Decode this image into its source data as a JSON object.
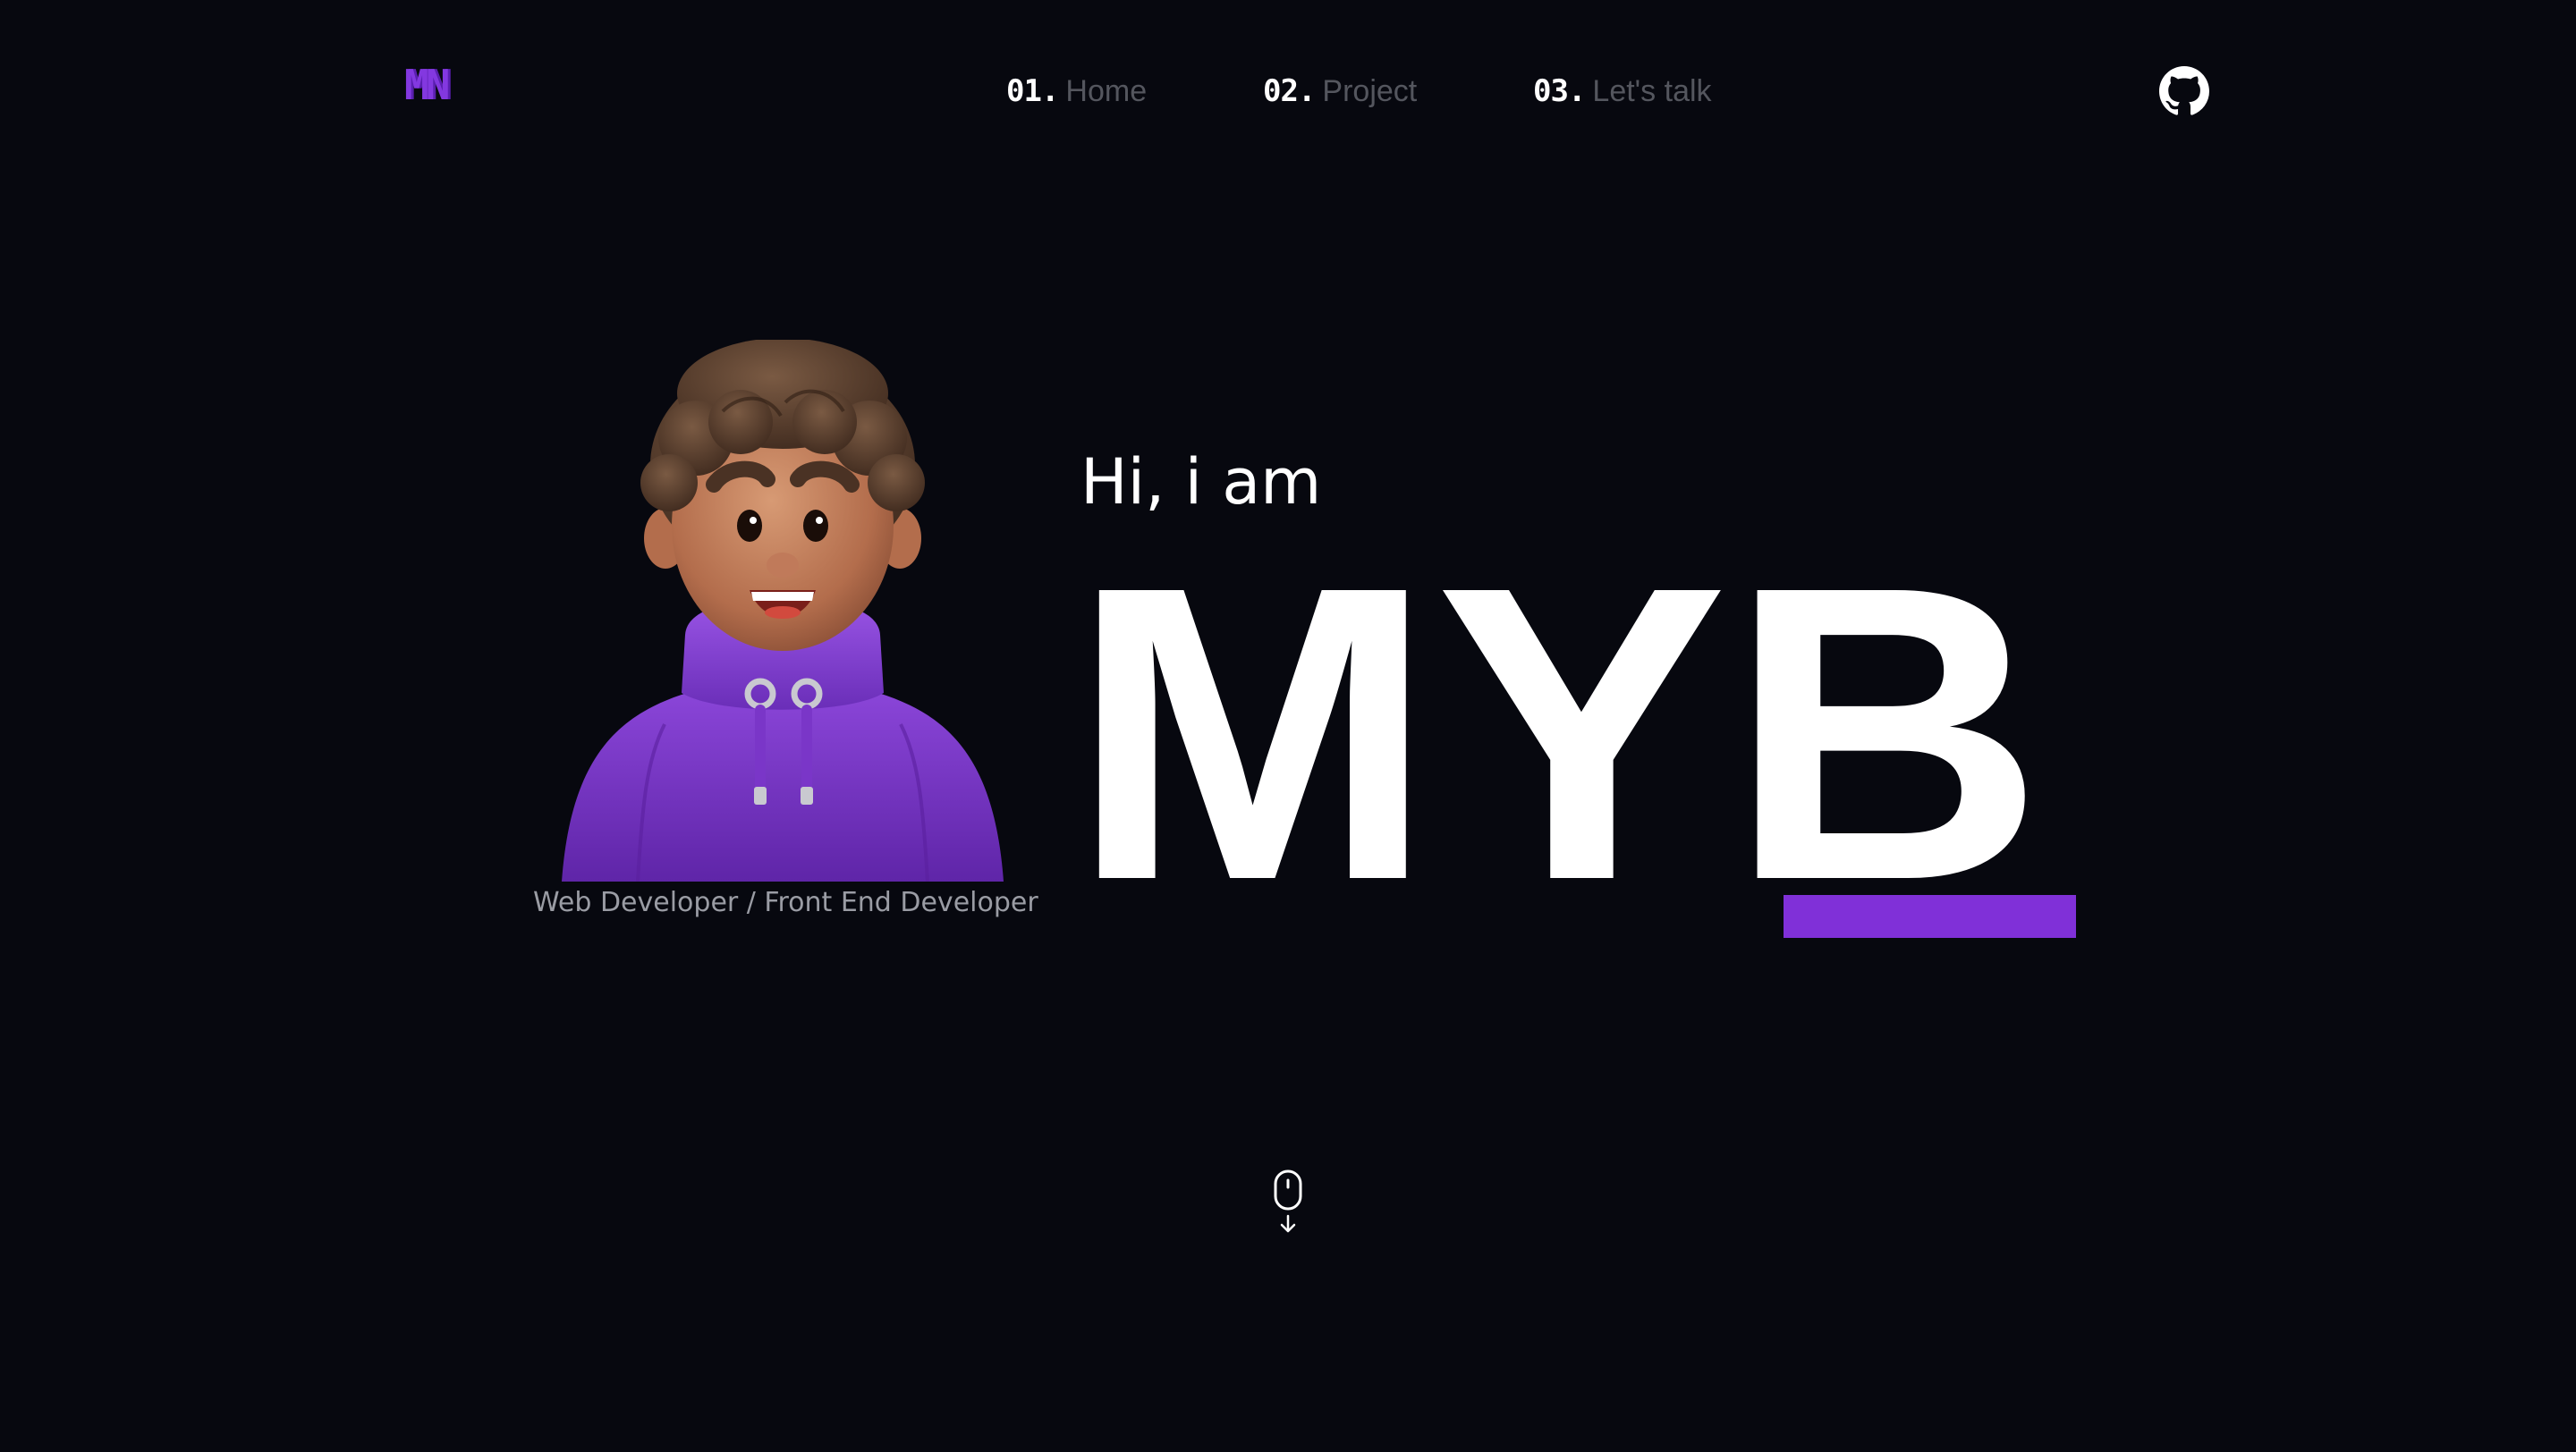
{
  "brand": {
    "logo": "MN",
    "accent": "#8030d8"
  },
  "nav": {
    "items": [
      {
        "num": "01.",
        "label": "Home"
      },
      {
        "num": "02.",
        "label": "Project"
      },
      {
        "num": "03.",
        "label": "Let's talk"
      }
    ],
    "github_icon": "github-icon"
  },
  "hero": {
    "greeting": "Hi, i am",
    "name": "MYB",
    "role": "Web Developer / Front End Developer",
    "avatar": "developer-avatar-illustration"
  },
  "scroll": {
    "icon": "mouse-scroll-icon"
  },
  "colors": {
    "background": "#07080f",
    "nav_label": "#54565e",
    "role_text": "#9a9ca4",
    "hoodie": "#7a36c8"
  }
}
